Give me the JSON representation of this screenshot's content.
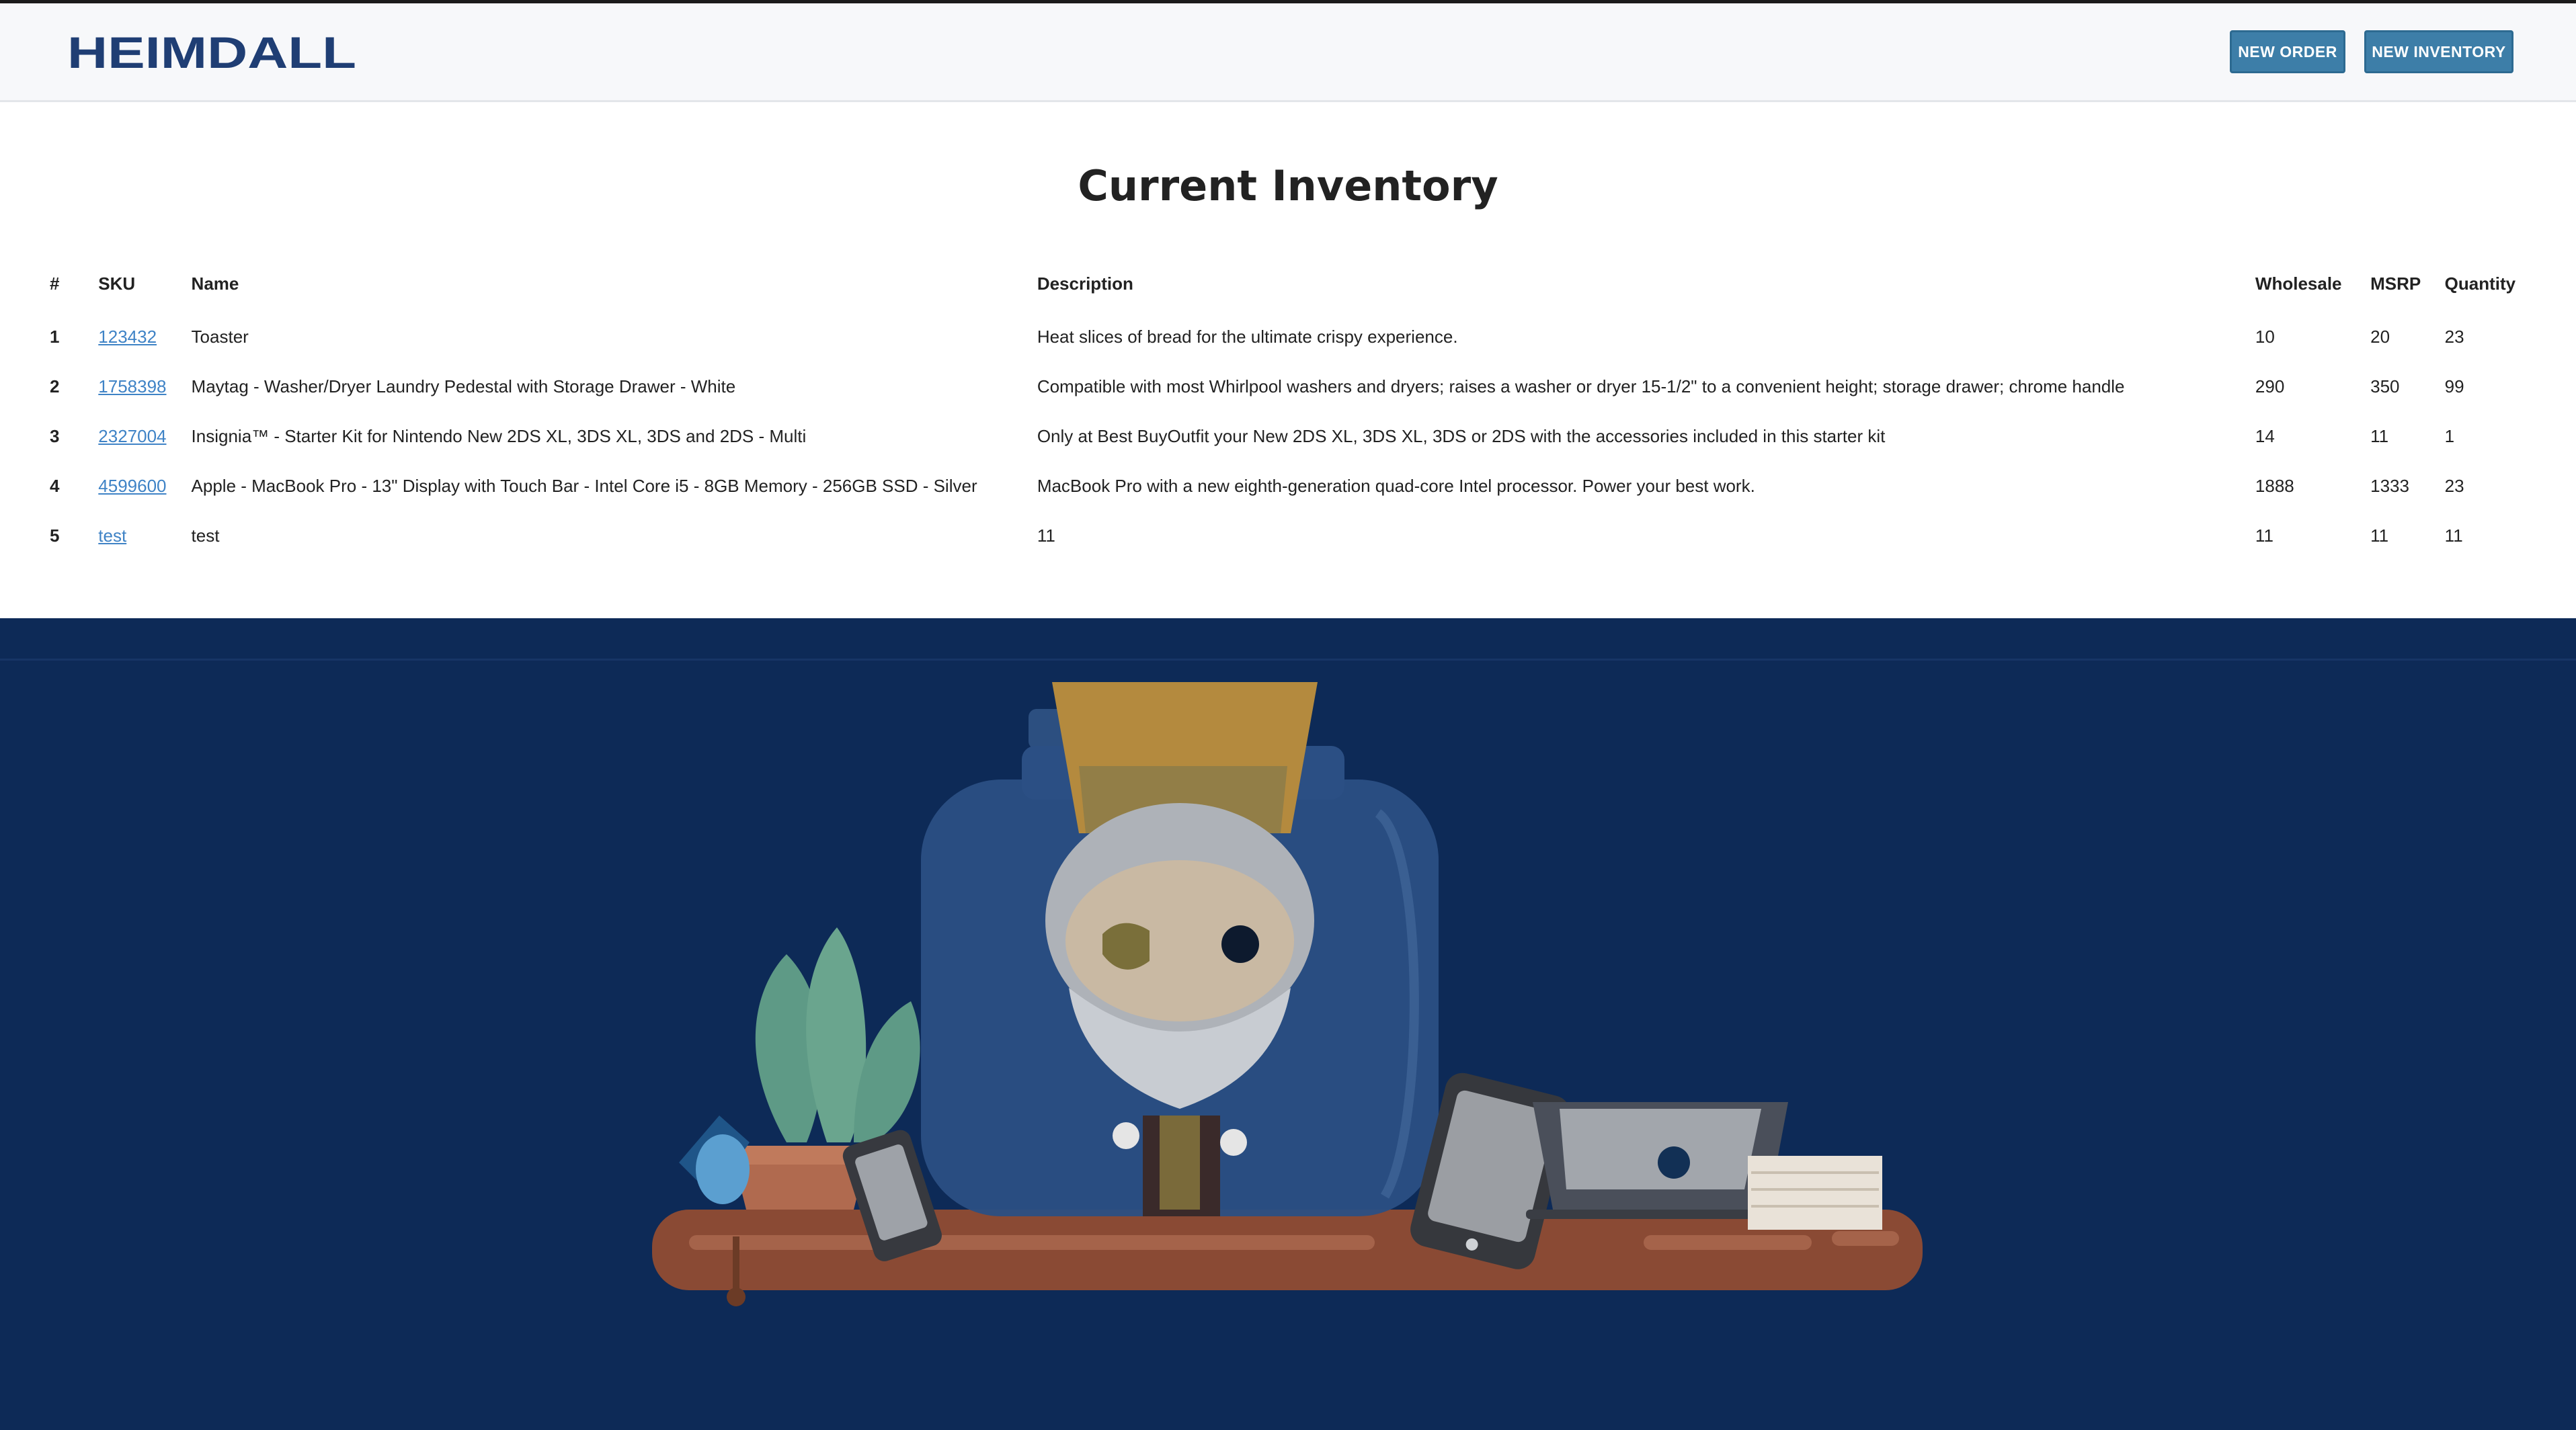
{
  "header": {
    "logo_text": "HEIMDALL",
    "buttons": {
      "new_order": "NEW ORDER",
      "new_inventory": "NEW INVENTORY"
    }
  },
  "page": {
    "title": "Current Inventory"
  },
  "table": {
    "headers": {
      "num": "#",
      "sku": "SKU",
      "name": "Name",
      "description": "Description",
      "wholesale": "Wholesale",
      "msrp": "MSRP",
      "quantity": "Quantity"
    },
    "rows": [
      {
        "num": "1",
        "sku": "123432",
        "name": "Toaster",
        "description": "Heat slices of bread for the ultimate crispy experience.",
        "wholesale": "10",
        "msrp": "20",
        "quantity": "23"
      },
      {
        "num": "2",
        "sku": "1758398",
        "name": "Maytag - Washer/Dryer Laundry Pedestal with Storage Drawer - White",
        "description": "Compatible with most Whirlpool washers and dryers; raises a washer or dryer 15-1/2\" to a convenient height; storage drawer; chrome handle",
        "wholesale": "290",
        "msrp": "350",
        "quantity": "99"
      },
      {
        "num": "3",
        "sku": "2327004",
        "name": "Insignia™ - Starter Kit for Nintendo New 2DS XL, 3DS XL, 3DS and 2DS - Multi",
        "description": "Only at Best BuyOutfit your New 2DS XL, 3DS XL, 3DS or 2DS with the accessories included in this starter kit",
        "wholesale": "14",
        "msrp": "11",
        "quantity": "1"
      },
      {
        "num": "4",
        "sku": "4599600",
        "name": "Apple - MacBook Pro - 13\" Display with Touch Bar - Intel Core i5 - 8GB Memory - 256GB SSD - Silver",
        "description": "MacBook Pro with a new eighth-generation quad-core Intel processor. Power your best work.",
        "wholesale": "1888",
        "msrp": "1333",
        "quantity": "23"
      },
      {
        "num": "5",
        "sku": "test",
        "name": "test",
        "description": "11",
        "wholesale": "11",
        "msrp": "11",
        "quantity": "11"
      }
    ]
  },
  "colors": {
    "brand_navy": "#0d2a57",
    "button_blue": "#3d7ea8",
    "link_blue": "#3f83c6"
  },
  "illustration": {
    "icon": "heimdall-jar-shelf-illustration"
  }
}
